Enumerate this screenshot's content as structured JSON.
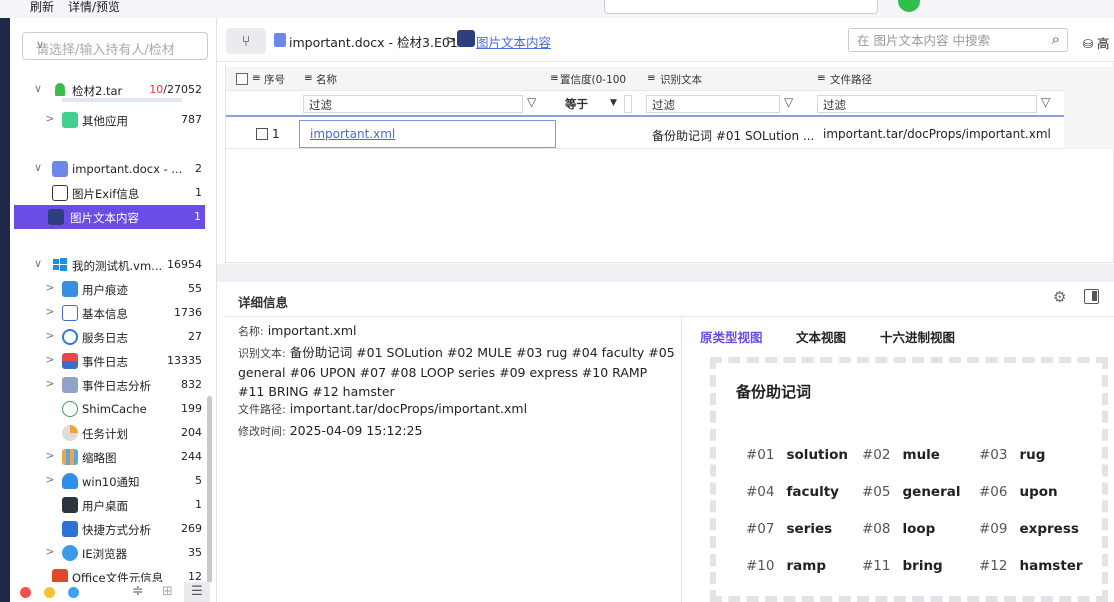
{
  "top_menu": {
    "refresh": "刷新",
    "detail_preview": "详情/预览"
  },
  "sidebar": {
    "owner_placeholder": "请选择/输入持有人/检材",
    "tree": [
      {
        "label": "检材2.tar",
        "count_red": "10",
        "count_rest": "/27052",
        "expand": "∨"
      },
      {
        "label": "其他应用",
        "count": "787",
        "expand": ">"
      },
      {
        "label": "important.docx - ...",
        "count": "2",
        "expand": "∨"
      },
      {
        "label": "图片Exif信息",
        "count": "1"
      },
      {
        "label": "图片文本内容",
        "count": "1"
      },
      {
        "label": "我的测试机.vm...",
        "count": "16954",
        "expand": "∨"
      },
      {
        "label": "用户痕迹",
        "count": "55",
        "expand": ">"
      },
      {
        "label": "基本信息",
        "count": "1736",
        "expand": ">"
      },
      {
        "label": "服务日志",
        "count": "27",
        "expand": ">"
      },
      {
        "label": "事件日志",
        "count": "13335",
        "expand": ">"
      },
      {
        "label": "事件日志分析",
        "count": "832",
        "expand": ">"
      },
      {
        "label": "ShimCache",
        "count": "199"
      },
      {
        "label": "任务计划",
        "count": "204"
      },
      {
        "label": "缩略图",
        "count": "244",
        "expand": ">"
      },
      {
        "label": "win10通知",
        "count": "5",
        "expand": ">"
      },
      {
        "label": "用户桌面",
        "count": "1"
      },
      {
        "label": "快捷方式分析",
        "count": "269"
      },
      {
        "label": "IE浏览器",
        "count": "35",
        "expand": ">"
      },
      {
        "label": "Office文件元信息",
        "count": "12"
      }
    ]
  },
  "breadcrumb": {
    "file": "important.docx - 检材3.E01",
    "sep": ">",
    "current": "图片文本内容"
  },
  "search": {
    "placeholder": "在 图片文本内容 中搜索"
  },
  "advanced_label": "高",
  "grid": {
    "columns": [
      "序号",
      "名称",
      "置信度(0-100",
      "识别文本",
      "文件路径"
    ],
    "filter_placeholder": "过滤",
    "confidence_op": "等于",
    "rows": [
      {
        "index": "1",
        "name": "important.xml",
        "ocr_text": "备份助记词 #01 SOLution ...",
        "path": "important.tar/docProps/important.xml"
      }
    ]
  },
  "details": {
    "title": "详细信息",
    "name_key": "名称:",
    "name_val": "important.xml",
    "ocr_key": "识别文本:",
    "ocr_val": "备份助记词 #01 SOLution #02 MULE #03 rug #04 faculty #05 general #06 UPON #07 #08 LOOP series #09 express #10 RAMP #11 BRING #12 hamster",
    "path_key": "文件路径:",
    "path_val": "important.tar/docProps/important.xml",
    "mtime_key": "修改时间:",
    "mtime_val": "2025-04-09 15:12:25",
    "tabs": [
      "原类型视图",
      "文本视图",
      "十六进制视图"
    ]
  },
  "preview": {
    "title": "备份助记词",
    "words": [
      {
        "n": "#01",
        "w": "solution"
      },
      {
        "n": "#02",
        "w": "mule"
      },
      {
        "n": "#03",
        "w": "rug"
      },
      {
        "n": "#04",
        "w": "faculty"
      },
      {
        "n": "#05",
        "w": "general"
      },
      {
        "n": "#06",
        "w": "upon"
      },
      {
        "n": "#07",
        "w": "series"
      },
      {
        "n": "#08",
        "w": "loop"
      },
      {
        "n": "#09",
        "w": "express"
      },
      {
        "n": "#10",
        "w": "ramp"
      },
      {
        "n": "#11",
        "w": "bring"
      },
      {
        "n": "#12",
        "w": "hamster"
      }
    ]
  },
  "colors": {
    "accent": "#6b4de6",
    "link": "#4b6bd6",
    "dark_edge": "#1e2746"
  }
}
